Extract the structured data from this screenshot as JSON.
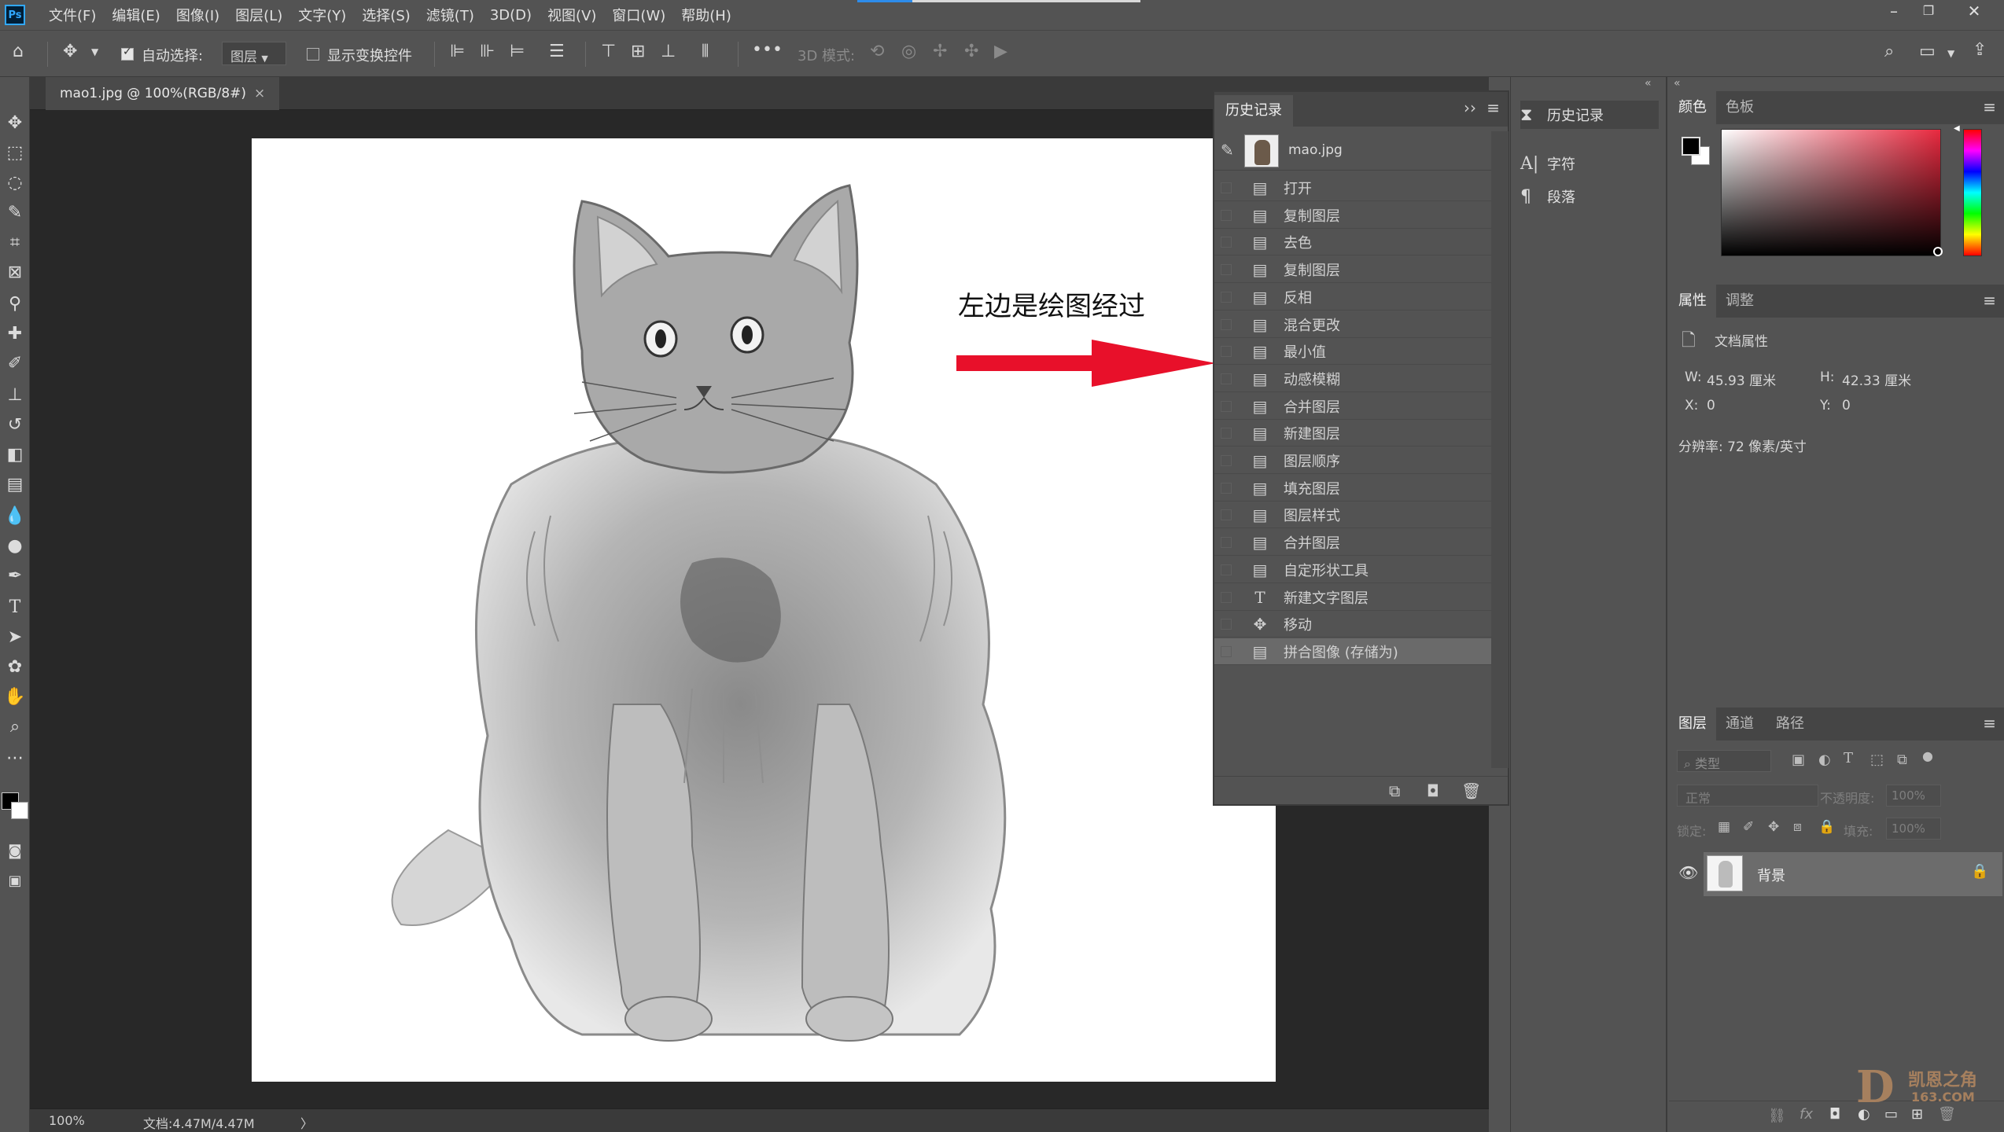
{
  "app": {
    "logo": "Ps"
  },
  "menu": [
    "文件(F)",
    "编辑(E)",
    "图像(I)",
    "图层(L)",
    "文字(Y)",
    "选择(S)",
    "滤镜(T)",
    "3D(D)",
    "视图(V)",
    "窗口(W)",
    "帮助(H)"
  ],
  "options": {
    "auto_select_label": "自动选择:",
    "auto_select_value": "图层",
    "show_transform_label": "显示变换控件",
    "mode_3d_label": "3D 模式:"
  },
  "document": {
    "tab_title": "mao1.jpg @ 100%(RGB/8#)",
    "tab_close": "×",
    "annotation": "左边是绘图经过",
    "zoom": "100%",
    "doc_size": "文档:4.47M/4.47M",
    "status_arrow": "〉"
  },
  "history_panel": {
    "title": "历史记录",
    "expand": "››",
    "snapshot_name": "mao.jpg",
    "items": [
      {
        "label": "打开",
        "icon": "document-icon"
      },
      {
        "label": "复制图层",
        "icon": "document-icon"
      },
      {
        "label": "去色",
        "icon": "document-icon"
      },
      {
        "label": "复制图层",
        "icon": "document-icon"
      },
      {
        "label": "反相",
        "icon": "document-icon"
      },
      {
        "label": "混合更改",
        "icon": "document-icon"
      },
      {
        "label": "最小值",
        "icon": "document-icon"
      },
      {
        "label": "动感模糊",
        "icon": "document-icon"
      },
      {
        "label": "合并图层",
        "icon": "document-icon"
      },
      {
        "label": "新建图层",
        "icon": "document-icon"
      },
      {
        "label": "图层顺序",
        "icon": "document-icon"
      },
      {
        "label": "填充图层",
        "icon": "document-icon"
      },
      {
        "label": "图层样式",
        "icon": "document-icon"
      },
      {
        "label": "合并图层",
        "icon": "document-icon"
      },
      {
        "label": "自定形状工具",
        "icon": "document-icon"
      },
      {
        "label": "新建文字图层",
        "icon": "text-icon"
      },
      {
        "label": "移动",
        "icon": "move-icon"
      },
      {
        "label": "拼合图像 (存储为)",
        "icon": "document-icon"
      }
    ],
    "active_index": 17
  },
  "icon_column": {
    "history": "历史记录",
    "character": "字符",
    "paragraph": "段落"
  },
  "color_panel": {
    "tab_color": "颜色",
    "tab_swatches": "色板"
  },
  "properties_panel": {
    "tab_properties": "属性",
    "tab_adjustments": "调整",
    "doc_props": "文档属性",
    "w_label": "W:",
    "w_value": "45.93 厘米",
    "h_label": "H:",
    "h_value": "42.33 厘米",
    "x_label": "X:",
    "x_value": "0",
    "y_label": "Y:",
    "y_value": "0",
    "resolution": "分辨率: 72 像素/英寸"
  },
  "layers_panel": {
    "tab_layers": "图层",
    "tab_channels": "通道",
    "tab_paths": "路径",
    "filter_placeholder": "类型",
    "blend_mode": "正常",
    "opacity_label": "不透明度:",
    "opacity_value": "100%",
    "lock_label": "锁定:",
    "fill_label": "填充:",
    "fill_value": "100%",
    "layer_name": "背景"
  },
  "watermark": {
    "letter": "D",
    "text1": "凯恩之角",
    "text2": "163.COM"
  },
  "colors": {
    "arrow": "#e8102a",
    "accent": "#31a8ff"
  }
}
